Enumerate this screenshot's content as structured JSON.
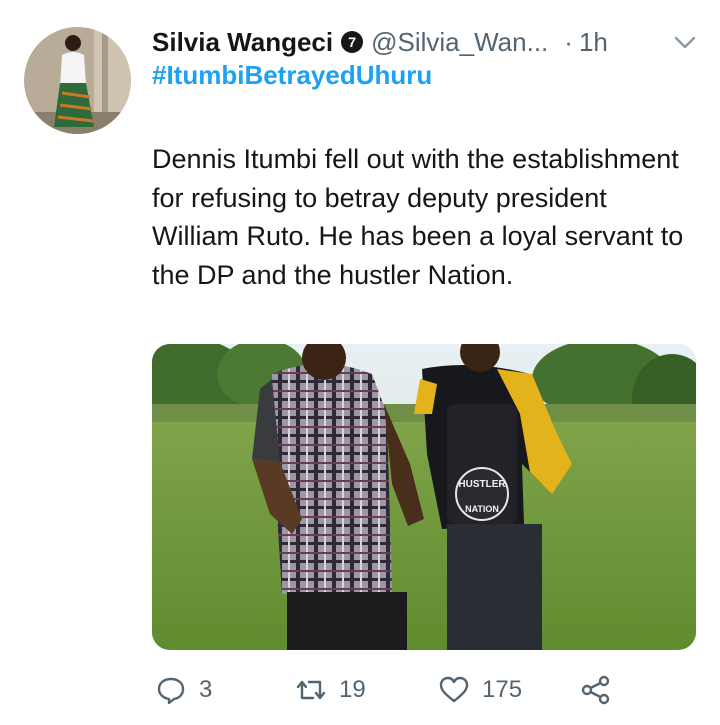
{
  "tweet": {
    "author_name": "Silvia Wangeci",
    "verified_glyph": "7",
    "handle": "@Silvia_Wan...",
    "dot": "·",
    "time": "1h",
    "hashtag": "#ItumbiBetrayedUhuru",
    "body": "Dennis Itumbi fell out with the establishment for refusing to betray deputy president William Ruto. He has been a loyal servant to the DP and the hustler Nation.",
    "media_shirt_text_1": "HUSTLER",
    "media_shirt_text_2": "NATION"
  },
  "actions": {
    "reply_count": "3",
    "retweet_count": "19",
    "like_count": "175"
  },
  "icons": [
    "chevron-down-icon",
    "reply-icon",
    "retweet-icon",
    "like-icon",
    "share-icon",
    "verified-icon"
  ],
  "colors": {
    "text": "#14171a",
    "muted": "#536471",
    "link": "#1da1f2"
  }
}
